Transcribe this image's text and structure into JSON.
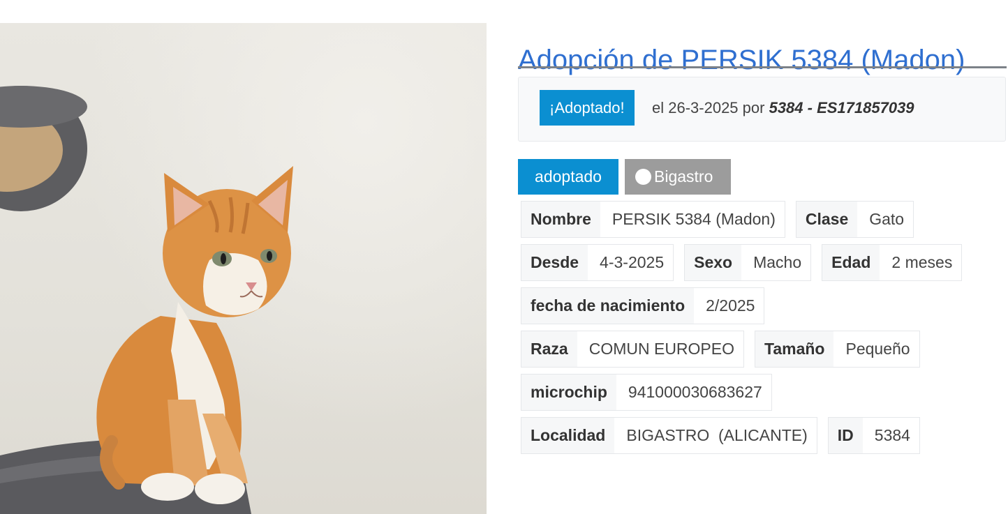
{
  "page": {
    "title": "Adopción de PERSIK 5384 (Madon)"
  },
  "adoption": {
    "badge": "¡Adoptado!",
    "text": "el 26-3-2025 por",
    "adopter": "5384 - ES171857039"
  },
  "tags": {
    "status": "adoptado",
    "location": "Bigastro"
  },
  "photo": {
    "subject": "orange-white-kitten-photo"
  },
  "fields": [
    [
      {
        "label": "Nombre",
        "value": "PERSIK 5384 (Madon)"
      },
      {
        "label": "Clase",
        "value": "Gato"
      }
    ],
    [
      {
        "label": "Desde",
        "value": "4-3-2025"
      },
      {
        "label": "Sexo",
        "value": "Macho"
      },
      {
        "label": "Edad",
        "value": "2 meses"
      }
    ],
    [
      {
        "label": "fecha de nacimiento",
        "value": "2/2025"
      }
    ],
    [
      {
        "label": "Raza",
        "value": "COMUN EUROPEO"
      },
      {
        "label": "Tamaño",
        "value": "Pequeño"
      }
    ],
    [
      {
        "label": "microchip",
        "value": "941000030683627"
      }
    ],
    [
      {
        "label": "Localidad",
        "value": "BIGASTRO  (ALICANTE)"
      },
      {
        "label": "ID",
        "value": "5384"
      }
    ]
  ],
  "colors": {
    "title": "#2f6fd0",
    "badge": "#0b8fd1",
    "location_tag": "#9c9c9c",
    "cat_orange": "#d98a3d"
  }
}
